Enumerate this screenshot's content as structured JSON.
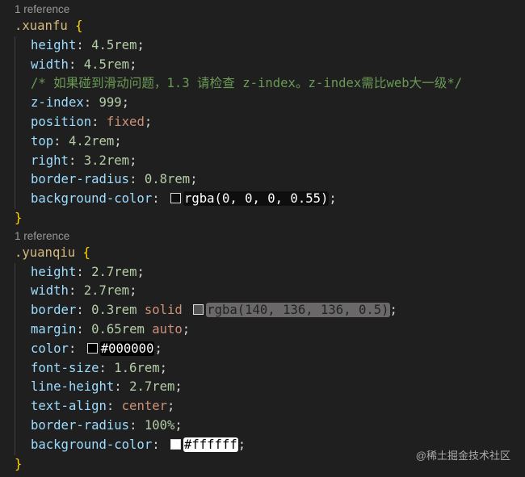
{
  "blocks": [
    {
      "reference": "1 reference",
      "selector": ".xuanfu",
      "lines": [
        {
          "prop": "height",
          "value": "4.5rem"
        },
        {
          "prop": "width",
          "value": "4.5rem"
        },
        {
          "comment": "/* 如果碰到滑动问题，1.3 请检查 z-index。z-index需比web大一级*/"
        },
        {
          "prop": "z-index",
          "value": "999"
        },
        {
          "prop": "position",
          "value": "fixed",
          "kw": true
        },
        {
          "prop": "top",
          "value": "4.2rem"
        },
        {
          "prop": "right",
          "value": "3.2rem"
        },
        {
          "prop": "border-radius",
          "value": "0.8rem"
        },
        {
          "prop": "background-color",
          "color": "rgba(0, 0, 0, 0.55)",
          "swatch": "rgba(0,0,0,0.55)"
        }
      ]
    },
    {
      "reference": "1 reference",
      "selector": ".yuanqiu",
      "lines": [
        {
          "prop": "height",
          "value": "2.7rem"
        },
        {
          "prop": "width",
          "value": "2.7rem"
        },
        {
          "prop": "border",
          "value": "0.3rem",
          "kw2": "solid",
          "color": "rgba(140, 136, 136, 0.5)",
          "swatch": "rgba(140,136,136,0.5)"
        },
        {
          "prop": "margin",
          "value": "0.65rem",
          "kw2": "auto"
        },
        {
          "prop": "color",
          "color": "#000000",
          "swatch": "#000000"
        },
        {
          "prop": "font-size",
          "value": "1.6rem"
        },
        {
          "prop": "line-height",
          "value": "2.7rem"
        },
        {
          "prop": "text-align",
          "value": "center",
          "kw": true
        },
        {
          "prop": "border-radius",
          "value": "100%"
        },
        {
          "prop": "background-color",
          "color": "#ffffff",
          "swatch": "#ffffff"
        }
      ]
    }
  ],
  "watermark": "@稀土掘金技术社区"
}
